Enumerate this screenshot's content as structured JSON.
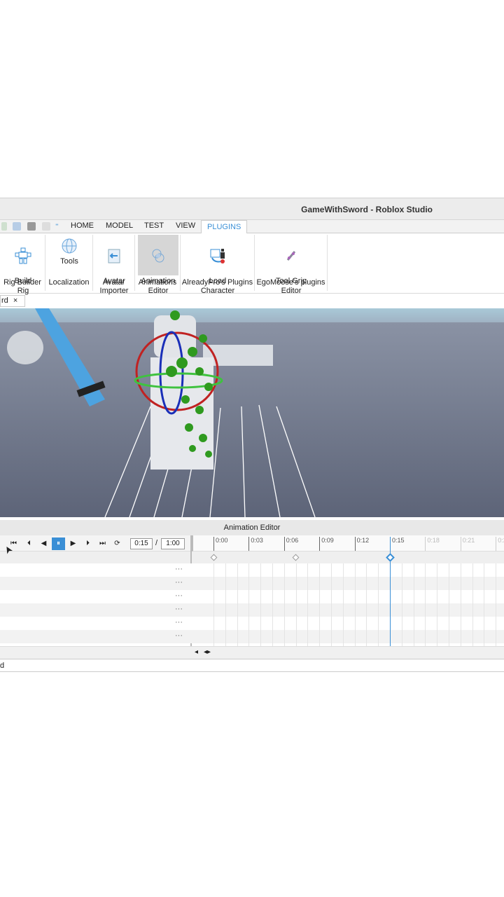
{
  "window": {
    "title": "GameWithSword - Roblox Studio"
  },
  "menu_tabs": [
    {
      "label": "HOME"
    },
    {
      "label": "MODEL"
    },
    {
      "label": "TEST"
    },
    {
      "label": "VIEW"
    },
    {
      "label": "PLUGINS",
      "active": true
    }
  ],
  "ribbon": {
    "groups": [
      {
        "label": "Rig Builder",
        "buttons": [
          {
            "label": "Build\nRig",
            "icon": "rig-icon"
          }
        ]
      },
      {
        "label": "Localization",
        "buttons": [
          {
            "label": "Tools",
            "icon": "globe-icon"
          }
        ]
      },
      {
        "label": "Avatar",
        "buttons": [
          {
            "label": "Avatar\nImporter",
            "icon": "import-icon"
          }
        ]
      },
      {
        "label": "Animations",
        "buttons": [
          {
            "label": "Animation\nEditor",
            "icon": "animation-icon",
            "selected": true
          }
        ]
      },
      {
        "label": "AlreadyPro's Plugins",
        "buttons": [
          {
            "label": "Load\nCharacter",
            "icon": "character-icon"
          }
        ]
      },
      {
        "label": "EgoMoose's plugins",
        "buttons": [
          {
            "label": "Tool Grip\nEditor",
            "icon": "tool-grip-icon"
          }
        ]
      }
    ]
  },
  "doc_tab": {
    "label": "rd",
    "close": "×"
  },
  "animation_editor": {
    "title": "Animation Editor",
    "current_time": "0:15",
    "separator": "/",
    "end_time": "1:00",
    "ruler_ticks": [
      "0:00",
      "0:03",
      "0:06",
      "0:09",
      "0:12",
      "0:15",
      "0:18",
      "0:21",
      "0:2"
    ],
    "keyframes_seconds": [
      0,
      7,
      15
    ],
    "playhead_seconds": 15,
    "track_menu": "···",
    "track_count": 6,
    "accent": "#3a8fd6"
  },
  "status": {
    "text": "d"
  }
}
